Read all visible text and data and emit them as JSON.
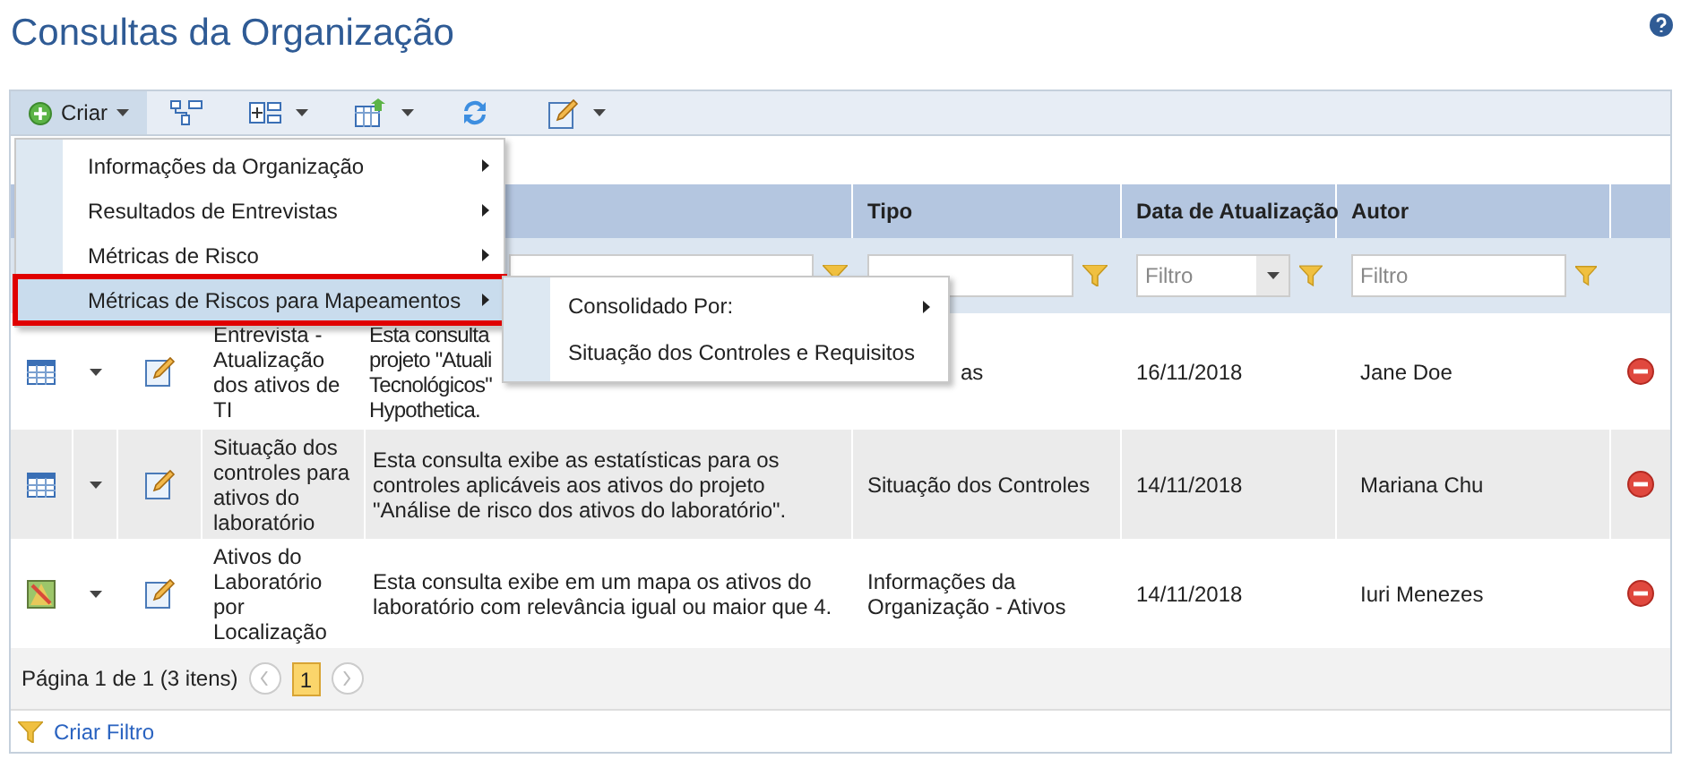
{
  "title": "Consultas da Organização",
  "toolbar": {
    "create_label": "Criar",
    "create_open": true
  },
  "create_menu": [
    {
      "label": "Informações da Organização",
      "selected": false
    },
    {
      "label": "Resultados de Entrevistas",
      "selected": false
    },
    {
      "label": "Métricas de Risco",
      "selected": false
    },
    {
      "label": "Métricas de Riscos para Mapeamentos",
      "selected": true
    }
  ],
  "submenu": [
    {
      "label": "Consolidado Por:",
      "has_submenu": true
    },
    {
      "label": "Situação dos Controles e Requisitos",
      "has_submenu": false
    }
  ],
  "table": {
    "columns": [
      "Tipo",
      "Data de Atualização",
      "Autor"
    ],
    "filters": [
      {
        "kind": "text"
      },
      {
        "kind": "text"
      },
      {
        "kind": "select",
        "placeholder": "Filtro"
      },
      {
        "kind": "text",
        "placeholder": "Filtro"
      }
    ],
    "rows": [
      {
        "kind": "table",
        "name": "Entrevista - Atualização dos ativos de TI",
        "description": "Esta consulta\nprojeto \"Atuali\nTecnológicos\"\nHypothetica.",
        "type": "as",
        "date": "16/11/2018",
        "author": "Jane Doe"
      },
      {
        "kind": "table",
        "name": "Situação dos controles para ativos do laboratório",
        "description": "Esta consulta exibe as estatísticas para os controles aplicáveis aos ativos do projeto \"Análise de risco dos ativos do laboratório\".",
        "type": "Situação dos Controles",
        "date": "14/11/2018",
        "author": "Mariana Chu"
      },
      {
        "kind": "map",
        "name": "Ativos do Laboratório por Localização",
        "description": "Esta consulta exibe em um mapa os ativos do laboratório com relevância igual ou maior que 4.",
        "type": "Informações da Organização - Ativos",
        "date": "14/11/2018",
        "author": "Iuri Menezes"
      }
    ]
  },
  "pager": {
    "summary": "Página 1 de 1 (3 itens)",
    "pages": [
      {
        "label": "1",
        "selected": true
      }
    ]
  },
  "footer": {
    "link": "Criar Filtro"
  }
}
